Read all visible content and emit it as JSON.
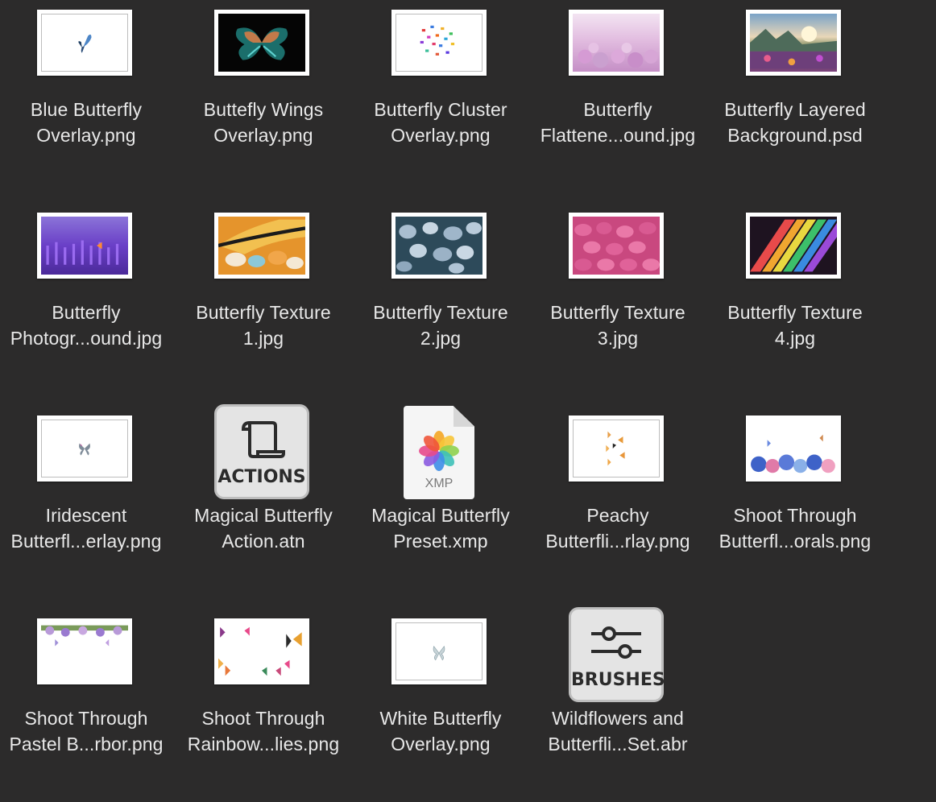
{
  "files": [
    {
      "line1": "Blue Butterfly",
      "line2": "Overlay.png",
      "kind": "image"
    },
    {
      "line1": "Buttefly Wings",
      "line2": "Overlay.png",
      "kind": "image"
    },
    {
      "line1": "Butterfly Cluster",
      "line2": "Overlay.png",
      "kind": "image"
    },
    {
      "line1": "Butterfly",
      "line2": "Flattene...ound.jpg",
      "kind": "image"
    },
    {
      "line1": "Butterfly Layered",
      "line2": "Background.psd",
      "kind": "image"
    },
    {
      "line1": "Butterfly",
      "line2": "Photogr...ound.jpg",
      "kind": "image"
    },
    {
      "line1": "Butterfly Texture",
      "line2": "1.jpg",
      "kind": "image"
    },
    {
      "line1": "Butterfly Texture",
      "line2": "2.jpg",
      "kind": "image"
    },
    {
      "line1": "Butterfly Texture",
      "line2": "3.jpg",
      "kind": "image"
    },
    {
      "line1": "Butterfly Texture",
      "line2": "4.jpg",
      "kind": "image"
    },
    {
      "line1": "Iridescent",
      "line2": "Butterfl...erlay.png",
      "kind": "image"
    },
    {
      "line1": "Magical Butterfly",
      "line2": "Action.atn",
      "kind": "actions",
      "icon_text": "ACTIONS"
    },
    {
      "line1": "Magical Butterfly",
      "line2": "Preset.xmp",
      "kind": "xmp",
      "icon_text": "XMP"
    },
    {
      "line1": "Peachy",
      "line2": "Butterfli...rlay.png",
      "kind": "image"
    },
    {
      "line1": "Shoot Through",
      "line2": "Butterfl...orals.png",
      "kind": "image"
    },
    {
      "line1": "Shoot Through",
      "line2": "Pastel B...rbor.png",
      "kind": "image"
    },
    {
      "line1": "Shoot Through",
      "line2": "Rainbow...lies.png",
      "kind": "image"
    },
    {
      "line1": "White Butterfly",
      "line2": "Overlay.png",
      "kind": "image"
    },
    {
      "line1": "Wildflowers and",
      "line2": "Butterfli...Set.abr",
      "kind": "brushes",
      "icon_text": "BRUSHES"
    }
  ]
}
